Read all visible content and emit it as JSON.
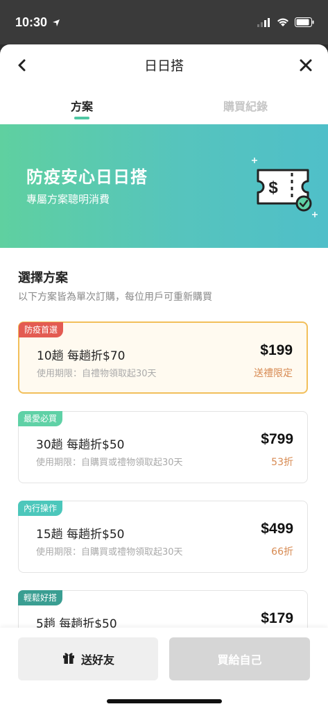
{
  "status": {
    "time": "10:30"
  },
  "nav": {
    "title": "日日搭"
  },
  "tabs": [
    {
      "label": "方案"
    },
    {
      "label": "購買紀錄"
    }
  ],
  "banner": {
    "title": "防疫安心日日搭",
    "subtitle": "專屬方案聰明消費"
  },
  "section": {
    "title": "選擇方案",
    "subtitle": "以下方案皆為單次訂購，每位用戶可重新購買"
  },
  "plans": [
    {
      "tag": "防疫首選",
      "tag_color": "#e35b52",
      "name": "10趟 每趟折$70",
      "desc": "使用期限：自禮物領取起30天",
      "price": "$199",
      "note": "送禮限定",
      "selected": true
    },
    {
      "tag": "最愛必買",
      "tag_color": "#5fd1a6",
      "name": "30趟 每趟折$50",
      "desc": "使用期限：自購買或禮物領取起30天",
      "price": "$799",
      "note": "53折"
    },
    {
      "tag": "內行操作",
      "tag_color": "#4cc7bb",
      "name": "15趟 每趟折$50",
      "desc": "使用期限：自購買或禮物領取起30天",
      "price": "$499",
      "note": "66折"
    },
    {
      "tag": "輕鬆好搭",
      "tag_color": "#3a9e92",
      "name": "5趟 每趟折$50",
      "desc": "",
      "price": "$179",
      "note": ""
    }
  ],
  "actions": {
    "gift_label": "送好友",
    "self_label": "買給自己"
  },
  "colors": {
    "accent": "#4fc7a3",
    "selected_border": "#f2bf5a",
    "note": "#d78a52"
  }
}
